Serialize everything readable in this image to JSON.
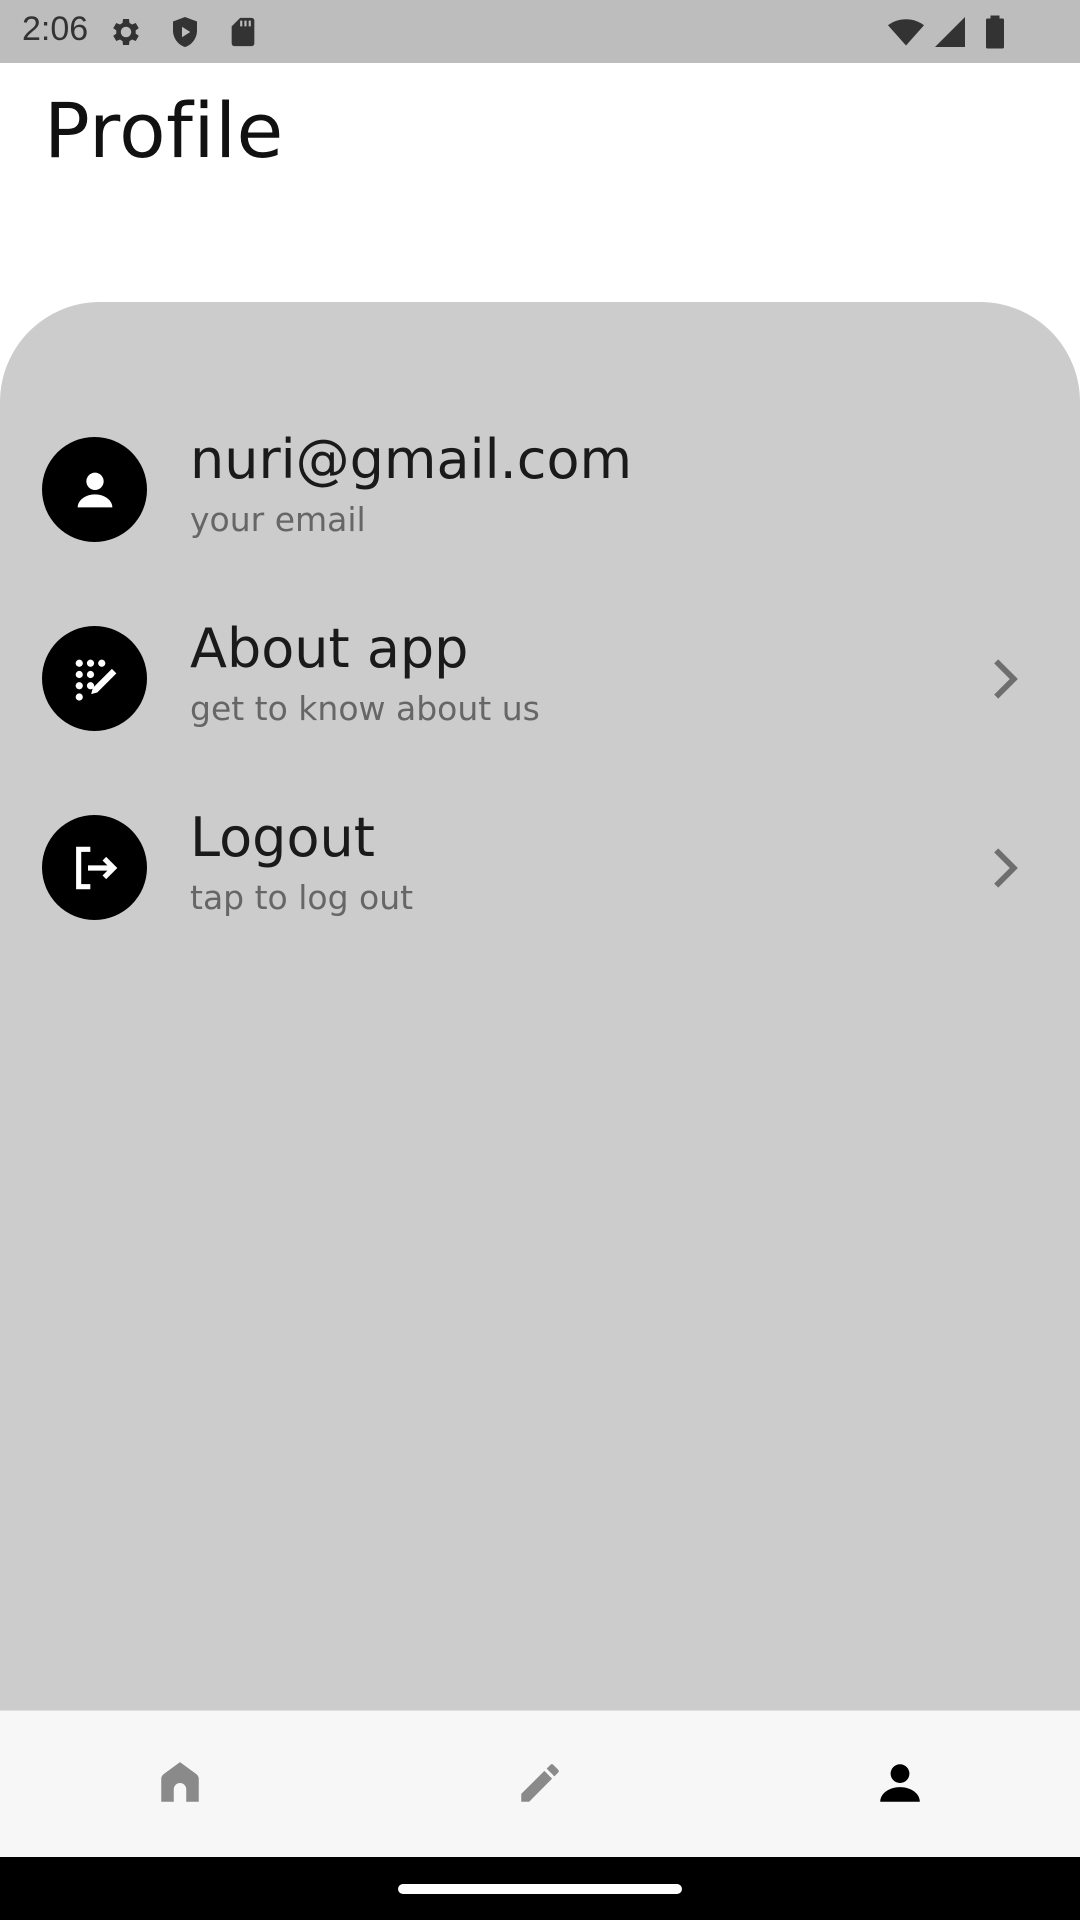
{
  "status_bar": {
    "time": "2:06",
    "left_icons": [
      "settings-icon",
      "shield-play-icon",
      "sd-card-icon"
    ],
    "right_icons": [
      "wifi-icon",
      "signal-icon",
      "battery-icon"
    ]
  },
  "header": {
    "title": "Profile"
  },
  "profile": {
    "items": [
      {
        "icon": "person-icon",
        "title": "nuri@gmail.com",
        "subtitle": "your email",
        "has_chevron": false
      },
      {
        "icon": "dialpad-edit-icon",
        "title": "About app",
        "subtitle": "get to know about us",
        "has_chevron": true
      },
      {
        "icon": "logout-icon",
        "title": "Logout",
        "subtitle": "tap to log out",
        "has_chevron": true
      }
    ]
  },
  "bottom_nav": {
    "items": [
      {
        "icon": "home-icon",
        "active": false
      },
      {
        "icon": "pencil-icon",
        "active": false
      },
      {
        "icon": "person-icon",
        "active": true
      }
    ]
  },
  "colors": {
    "sheet_bg": "#cccccc",
    "icon_circle": "#000000",
    "nav_active": "#000000",
    "nav_inactive": "#8a8a8a"
  }
}
